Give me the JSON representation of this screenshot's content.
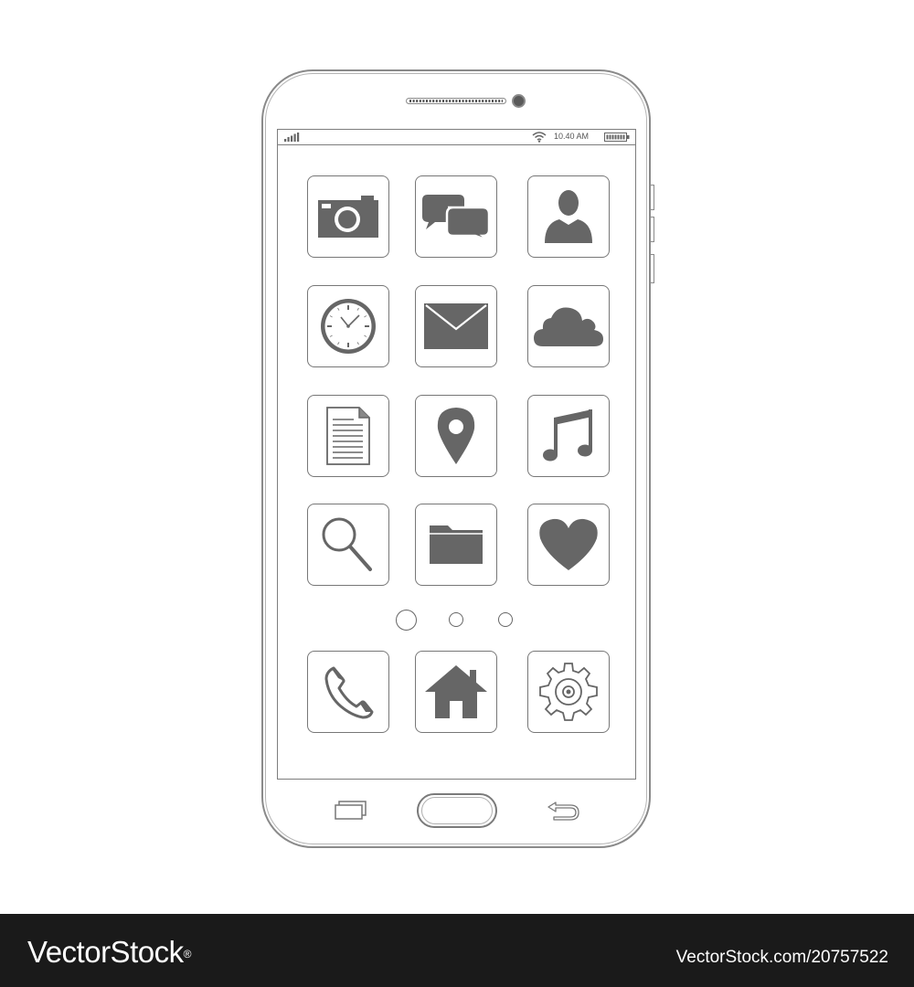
{
  "status_bar": {
    "signal_icon": "signal-bars-icon",
    "wifi_icon": "wifi-icon",
    "time": "10.40 AM",
    "battery_icon": "battery-icon"
  },
  "home_screen": {
    "apps": [
      {
        "id": "camera",
        "icon": "camera-icon"
      },
      {
        "id": "messages",
        "icon": "chat-bubbles-icon"
      },
      {
        "id": "contacts",
        "icon": "person-icon"
      },
      {
        "id": "clock",
        "icon": "clock-icon"
      },
      {
        "id": "mail",
        "icon": "envelope-icon"
      },
      {
        "id": "cloud",
        "icon": "cloud-icon"
      },
      {
        "id": "documents",
        "icon": "document-icon"
      },
      {
        "id": "maps",
        "icon": "map-pin-icon"
      },
      {
        "id": "music",
        "icon": "music-note-icon"
      },
      {
        "id": "search",
        "icon": "magnifier-icon"
      },
      {
        "id": "files",
        "icon": "folder-icon"
      },
      {
        "id": "favorites",
        "icon": "heart-icon"
      }
    ],
    "page_indicator": {
      "pages": 3,
      "current": 1
    },
    "dock": [
      {
        "id": "phone",
        "icon": "phone-handset-icon"
      },
      {
        "id": "home",
        "icon": "house-icon"
      },
      {
        "id": "settings",
        "icon": "gear-icon"
      }
    ]
  },
  "hardware_buttons": {
    "recent_apps_icon": "recent-apps-icon",
    "home_button": "home-button",
    "back_icon": "back-arrow-icon"
  },
  "watermark": {
    "brand": "VectorStock",
    "registered": "®",
    "image_ref": "VectorStock.com/20757522"
  },
  "colors": {
    "outline": "#8a8a8a",
    "icon_fill": "#666666",
    "footer_bg": "#1a1a1a"
  }
}
